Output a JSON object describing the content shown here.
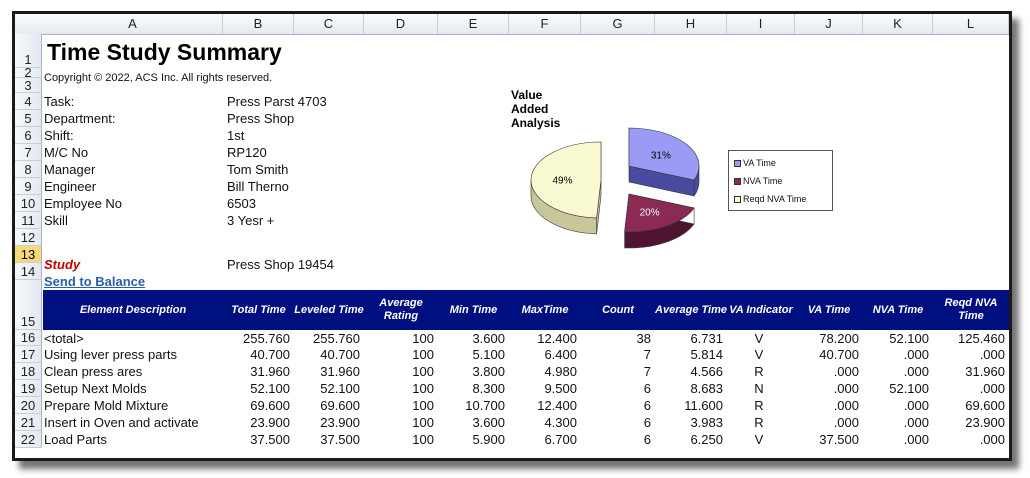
{
  "columns": [
    "A",
    "B",
    "C",
    "D",
    "E",
    "F",
    "G",
    "H",
    "I",
    "J",
    "K",
    "L"
  ],
  "rows": [
    "1",
    "2",
    "3",
    "4",
    "5",
    "6",
    "7",
    "8",
    "9",
    "10",
    "11",
    "12",
    "13",
    "14",
    "15",
    "16",
    "17",
    "18",
    "19",
    "20",
    "21",
    "22"
  ],
  "header": {
    "title": "Time Study Summary",
    "copyright": "Copyright © 2022, ACS Inc.  All rights reserved."
  },
  "info": [
    {
      "label": "Task:",
      "value": "Press Parst 4703"
    },
    {
      "label": "Department:",
      "value": "Press Shop"
    },
    {
      "label": "Shift:",
      "value": "1st"
    },
    {
      "label": "M/C No",
      "value": "RP120"
    },
    {
      "label": "Manager",
      "value": "Tom Smith"
    },
    {
      "label": "Engineer",
      "value": "Bill Therno"
    },
    {
      "label": "Employee No",
      "value": "6503"
    },
    {
      "label": "Skill",
      "value": "3 Yesr +"
    }
  ],
  "study": {
    "label": "Study",
    "value": "Press Shop 19454"
  },
  "send_link": "Send to Balance",
  "chart": {
    "title": "Value Added Analysis",
    "slices": [
      {
        "name": "VA Time",
        "label": "31%",
        "value": 31,
        "color": "#9b9bf5",
        "side": "#4a4aa0"
      },
      {
        "name": "NVA Time",
        "label": "20%",
        "value": 20,
        "color": "#8a2a55",
        "side": "#4e1430"
      },
      {
        "name": "Reqd NVA Time",
        "label": "49%",
        "value": 49,
        "color": "#fafad2",
        "side": "#c9c79a"
      }
    ]
  },
  "table": {
    "headers": [
      "Element Description",
      "Total Time",
      "Leveled Time",
      "Average Rating",
      "Min Time",
      "MaxTime",
      "Count",
      "Average Time",
      "VA Indicator",
      "VA Time",
      "NVA Time",
      "Reqd NVA Time"
    ],
    "rows": [
      [
        "<total>",
        "255.760",
        "255.760",
        "100",
        "3.600",
        "12.400",
        "38",
        "6.731",
        "V",
        "78.200",
        "52.100",
        "125.460"
      ],
      [
        "Using lever press parts",
        "40.700",
        "40.700",
        "100",
        "5.100",
        "6.400",
        "7",
        "5.814",
        "V",
        "40.700",
        ".000",
        ".000"
      ],
      [
        "Clean press ares",
        "31.960",
        "31.960",
        "100",
        "3.800",
        "4.980",
        "7",
        "4.566",
        "R",
        ".000",
        ".000",
        "31.960"
      ],
      [
        "Setup Next Molds",
        "52.100",
        "52.100",
        "100",
        "8.300",
        "9.500",
        "6",
        "8.683",
        "N",
        ".000",
        "52.100",
        ".000"
      ],
      [
        "Prepare Mold Mixture",
        "69.600",
        "69.600",
        "100",
        "10.700",
        "12.400",
        "6",
        "11.600",
        "R",
        ".000",
        ".000",
        "69.600"
      ],
      [
        "Insert in Oven and activate",
        "23.900",
        "23.900",
        "100",
        "3.600",
        "4.300",
        "6",
        "3.983",
        "R",
        ".000",
        ".000",
        "23.900"
      ],
      [
        "Load Parts",
        "37.500",
        "37.500",
        "100",
        "5.900",
        "6.700",
        "6",
        "6.250",
        "V",
        "37.500",
        ".000",
        ".000"
      ]
    ]
  }
}
